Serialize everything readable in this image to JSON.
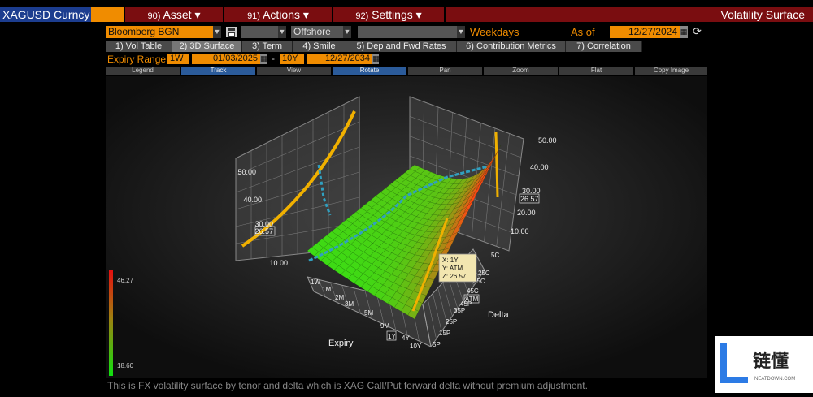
{
  "topbar": {
    "ticker": "XAGUSD Curncy",
    "menus": [
      {
        "num": "90)",
        "label": "Asset ▾"
      },
      {
        "num": "91)",
        "label": "Actions ▾"
      },
      {
        "num": "92)",
        "label": "Settings ▾"
      }
    ],
    "title": "Volatility Surface"
  },
  "controls": {
    "source": "Bloomberg BGN",
    "market": "Offshore",
    "day_count": "Weekdays",
    "as_of_label": "As of",
    "as_of_date": "12/27/2024"
  },
  "tabs": [
    {
      "label": "1) Vol Table"
    },
    {
      "label": "2) 3D Surface"
    },
    {
      "label": "3) Term"
    },
    {
      "label": "4) Smile"
    },
    {
      "label": "5) Dep and Fwd Rates"
    },
    {
      "label": "6) Contribution Metrics"
    },
    {
      "label": "7) Correlation"
    }
  ],
  "range": {
    "label": "Expiry Range",
    "from_tenor": "1W",
    "from_date": "01/03/2025",
    "dash": "-",
    "to_tenor": "10Y",
    "to_date": "12/27/2034"
  },
  "toolbar": [
    "Legend",
    "Track",
    "View",
    "Rotate",
    "Pan",
    "Zoom",
    "Flat",
    "Copy Image"
  ],
  "chart_data": {
    "type": "surface",
    "x_label": "Expiry",
    "y_label": "Delta",
    "expiry_ticks": [
      "1W",
      "1M",
      "2M",
      "3M",
      "5M",
      "9M",
      "1Y",
      "4Y",
      "10Y"
    ],
    "delta_ticks": [
      "5C",
      "25C",
      "35C",
      "45C",
      "ATM",
      "45P",
      "35P",
      "25P",
      "15P",
      "5P"
    ],
    "left_wall_ticks": [
      "50.00",
      "40.00",
      "30.00",
      "26.57",
      "10.00"
    ],
    "right_wall_ticks": [
      "50.00",
      "40.00",
      "30.00",
      "26.57",
      "20.00",
      "10.00"
    ],
    "colorbar": {
      "max": "46.27",
      "min": "18.60"
    },
    "tooltip": {
      "x": "X: 1Y",
      "y": "Y: ATM",
      "z": "Z: 26.57"
    },
    "z_range": [
      10,
      50
    ]
  },
  "footer": "This is FX volatility surface by tenor and delta which is XAG Call/Put forward delta without premium adjustment."
}
